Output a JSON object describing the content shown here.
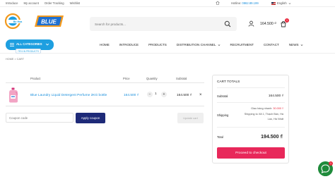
{
  "topbar": {
    "links": [
      "Introduce",
      "My account",
      "Order Tracking",
      "Wishlist"
    ],
    "hotline_label": "Hotline:",
    "hotline_number": "0862.89.199",
    "language": "English"
  },
  "logo": {
    "brand_left": "Bo Hoa",
    "brand_right": "BLUE",
    "accent": "#1e9fe0"
  },
  "search": {
    "placeholder": "Search for products..."
  },
  "header": {
    "cart_total": "164.500 ₫",
    "cart_count": "1"
  },
  "nav": {
    "all_categories": "ALL CATEGORIES",
    "all_categories_sub": "7574 IN PRODUCTS",
    "items": [
      {
        "label": "HOME",
        "dropdown": false
      },
      {
        "label": "INTRODUCE",
        "dropdown": false
      },
      {
        "label": "PRODUCTS",
        "dropdown": false
      },
      {
        "label": "DISTRIBUTION CHANNEL",
        "dropdown": true
      },
      {
        "label": "RECRUITMENT",
        "dropdown": false
      },
      {
        "label": "CONTACT",
        "dropdown": false
      },
      {
        "label": "NEWS",
        "dropdown": true
      }
    ]
  },
  "breadcrumb": {
    "home": "HOME",
    "sep": ">",
    "current": "CART"
  },
  "cart_table": {
    "headers": {
      "product": "Product",
      "price": "Price",
      "quantity": "Quantity",
      "subtotal": "Subtotal"
    },
    "item": {
      "name": "Blue Laundry Liquid Detergent Perfume 2KG bottle",
      "price": "164.500 ₫",
      "quantity": "1",
      "subtotal": "164.500 ₫",
      "remove": "×"
    }
  },
  "coupon": {
    "placeholder": "Coupon code",
    "apply_label": "Apply coupon",
    "update_label": "Update cart"
  },
  "totals": {
    "title": "CART TOTALS",
    "subtotal_label": "Subtotal",
    "subtotal_value": "164.500 ₫",
    "shipping_label": "Shipping",
    "shipping_method": "Giao hàng nhanh:",
    "shipping_cost": "30.000 ₫",
    "shipping_to_1": "Shipping to Xã 1, Thạch Bàn, Hà",
    "shipping_to_2": "Lao, Hà Nhất",
    "total_label": "Total",
    "total_value": "194.500 ₫",
    "checkout_label": "Proceed to checkout"
  },
  "chat": {
    "badge": "1"
  }
}
